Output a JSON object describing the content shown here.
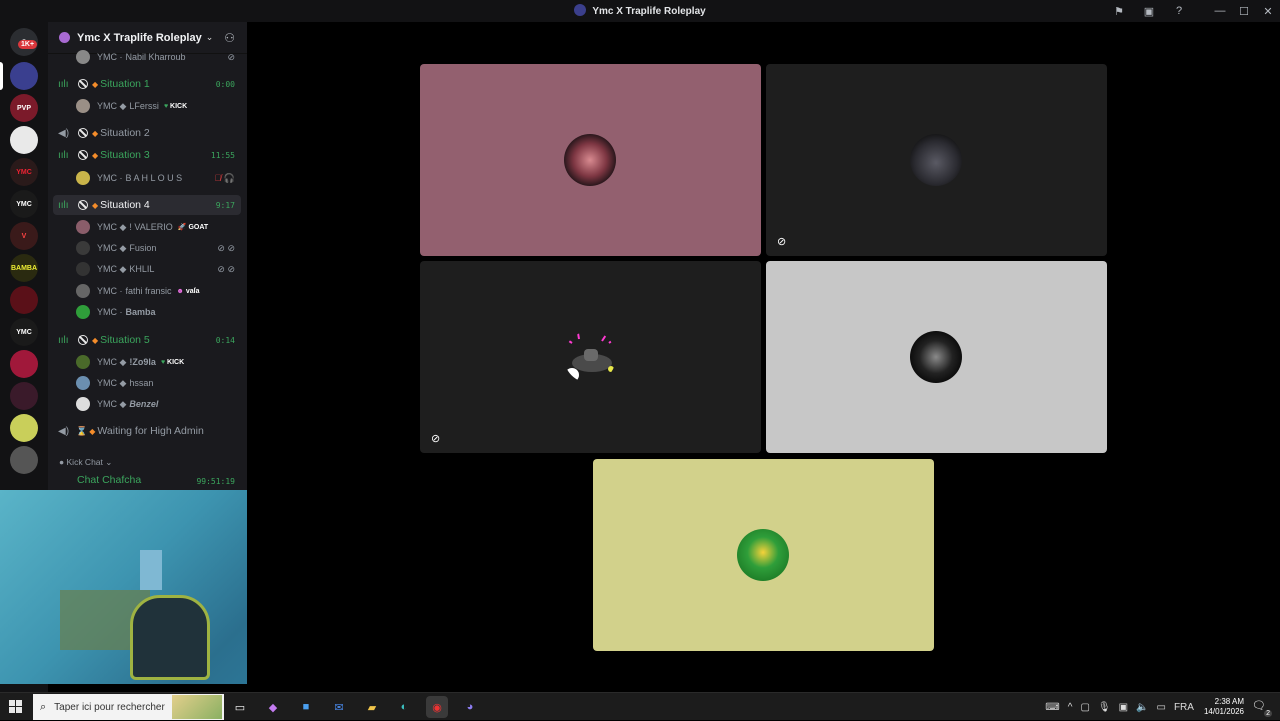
{
  "window": {
    "title": "Ymc X Traplife Roleplay"
  },
  "rail": {
    "badge": "1K+",
    "servers": [
      "YMC",
      "PVP",
      "",
      "YMC",
      "YMC",
      "V",
      "BAMBA",
      "",
      "YMC",
      "",
      "",
      "",
      ""
    ]
  },
  "guild": {
    "name": "Ymc X Traplife Roleplay"
  },
  "channels": [
    {
      "name": "Situation 1",
      "timer": "0:00",
      "state": "live"
    },
    {
      "name": "Situation 2",
      "timer": "",
      "state": "muted"
    },
    {
      "name": "Situation 3",
      "timer": "11:55",
      "state": "live"
    },
    {
      "name": "Situation 4",
      "timer": "9:17",
      "state": "active"
    },
    {
      "name": "Situation 5",
      "timer": "0:14",
      "state": "live"
    },
    {
      "name": "Waiting for High Admin",
      "timer": "",
      "state": "muted"
    }
  ],
  "users": {
    "top": {
      "tag": "YMC ·",
      "name": "Nabil Kharroub"
    },
    "s1": [
      {
        "tag": "YMC ◆",
        "name": "LFerssi",
        "badge": "KICK"
      }
    ],
    "s3": [
      {
        "tag": "YMC ·",
        "name": "B A H L O U S"
      }
    ],
    "s4": [
      {
        "tag": "YMC ◆",
        "name": "! VALERIO",
        "badge": "GOAT"
      },
      {
        "tag": "YMC ◆",
        "name": "Fusion"
      },
      {
        "tag": "YMC ◆",
        "name": "KHLIL"
      },
      {
        "tag": "YMC ·",
        "name": "fathi fransic",
        "badge": "vaſa"
      },
      {
        "tag": "YMC ·",
        "name": "Bamba"
      }
    ],
    "s5": [
      {
        "tag": "YMC ◆",
        "name": "!Zo9la",
        "badge": "KICK"
      },
      {
        "tag": "YMC ◆",
        "name": "hssan"
      },
      {
        "tag": "YMC ◆",
        "name": "Benzel"
      }
    ]
  },
  "category": {
    "label": "Kick Chat"
  },
  "chafcha": {
    "name": "Chat Chafcha",
    "timer": "99:51:19"
  },
  "taskbar": {
    "search_placeholder": "Taper ici pour rechercher",
    "lang": "FRA",
    "time": "2:38 AM",
    "date": "14/01/2026",
    "notif_count": "2"
  }
}
